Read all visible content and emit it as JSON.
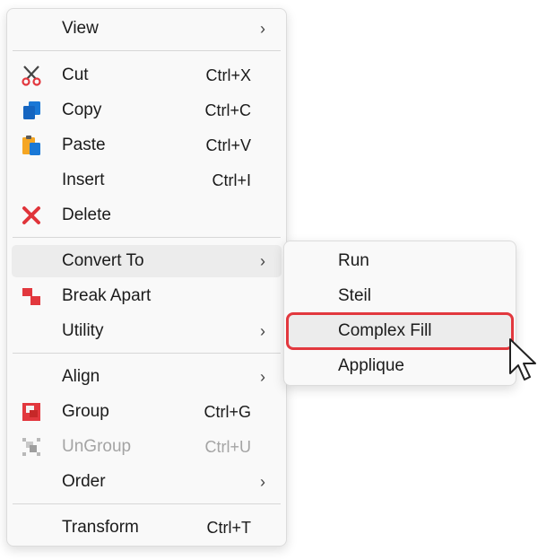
{
  "main_menu": {
    "items": [
      {
        "label": "View"
      },
      {
        "label": "Cut",
        "shortcut": "Ctrl+X",
        "icon": "scissors-icon"
      },
      {
        "label": "Copy",
        "shortcut": "Ctrl+C",
        "icon": "copy-icon"
      },
      {
        "label": "Paste",
        "shortcut": "Ctrl+V",
        "icon": "paste-icon"
      },
      {
        "label": "Insert",
        "shortcut": "Ctrl+I"
      },
      {
        "label": "Delete",
        "icon": "delete-x-icon"
      },
      {
        "label": "Convert To"
      },
      {
        "label": "Break Apart",
        "icon": "break-apart-icon"
      },
      {
        "label": "Utility"
      },
      {
        "label": "Align"
      },
      {
        "label": "Group",
        "shortcut": "Ctrl+G",
        "icon": "group-icon"
      },
      {
        "label": "UnGroup",
        "shortcut": "Ctrl+U",
        "icon": "ungroup-icon",
        "disabled": true
      },
      {
        "label": "Order"
      },
      {
        "label": "Transform",
        "shortcut": "Ctrl+T"
      }
    ]
  },
  "sub_menu": {
    "items": [
      {
        "label": "Run"
      },
      {
        "label": "Steil"
      },
      {
        "label": "Complex Fill"
      },
      {
        "label": "Applique"
      }
    ]
  },
  "colors": {
    "highlight_outline": "#e2383e",
    "delete_red": "#e0343a",
    "copy_blue": "#1a78d6",
    "paste_orange": "#f5a623"
  }
}
